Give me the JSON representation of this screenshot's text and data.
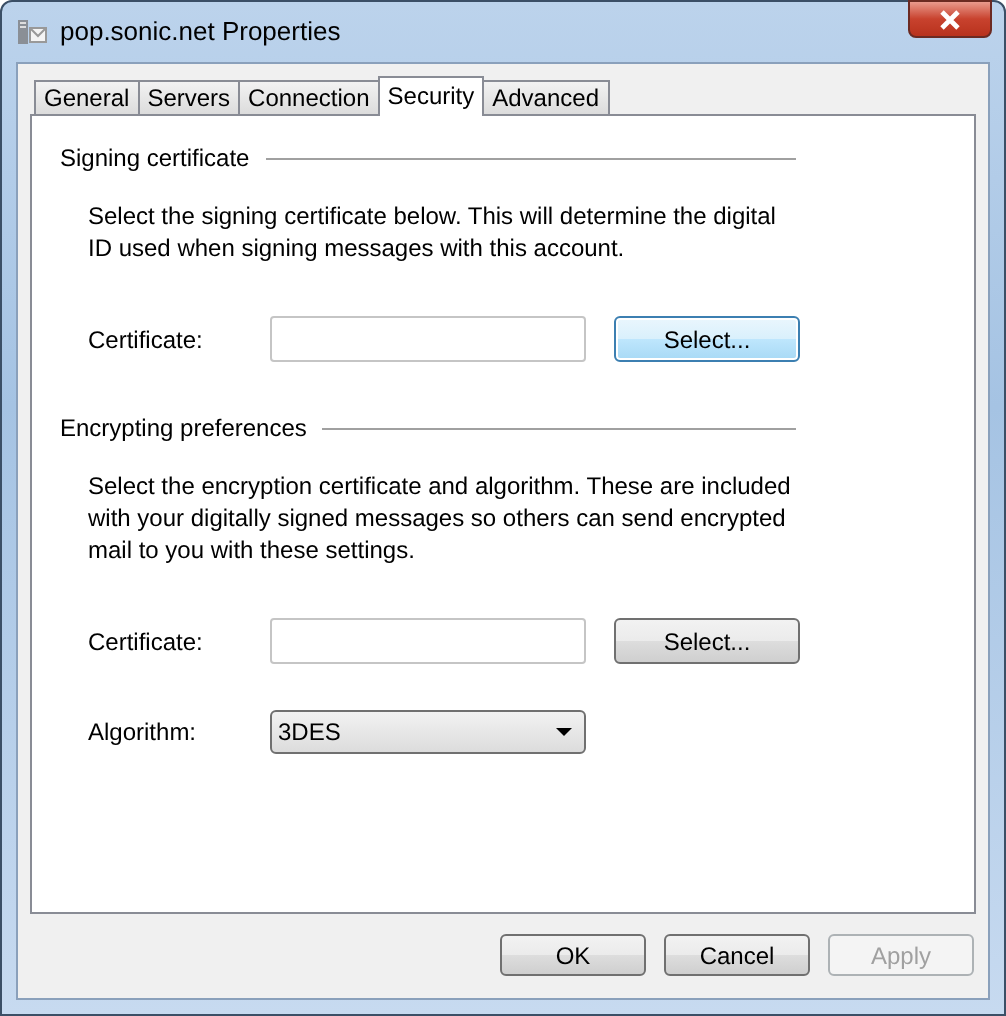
{
  "window": {
    "title": "pop.sonic.net Properties"
  },
  "tabs": [
    {
      "label": "General",
      "selected": false
    },
    {
      "label": "Servers",
      "selected": false
    },
    {
      "label": "Connection",
      "selected": false
    },
    {
      "label": "Security",
      "selected": true
    },
    {
      "label": "Advanced",
      "selected": false
    }
  ],
  "sections": [
    {
      "heading": "Signing certificate",
      "description": "Select the signing certificate below. This will determine the digital ID used when signing messages with this account.",
      "fields": [
        {
          "kind": "certificate",
          "label": "Certificate:",
          "button": "Select...",
          "focused": true
        }
      ]
    },
    {
      "heading": "Encrypting preferences",
      "description": "Select the encryption certificate and algorithm. These are included with your digitally signed messages so others can send encrypted mail to you with these settings.",
      "fields": [
        {
          "kind": "certificate",
          "label": "Certificate:",
          "button": "Select...",
          "focused": false
        },
        {
          "kind": "select",
          "label": "Algorithm:",
          "value": "3DES"
        }
      ]
    }
  ],
  "buttons": [
    {
      "label": "OK",
      "disabled": false
    },
    {
      "label": "Cancel",
      "disabled": false
    },
    {
      "label": "Apply",
      "disabled": true
    }
  ]
}
